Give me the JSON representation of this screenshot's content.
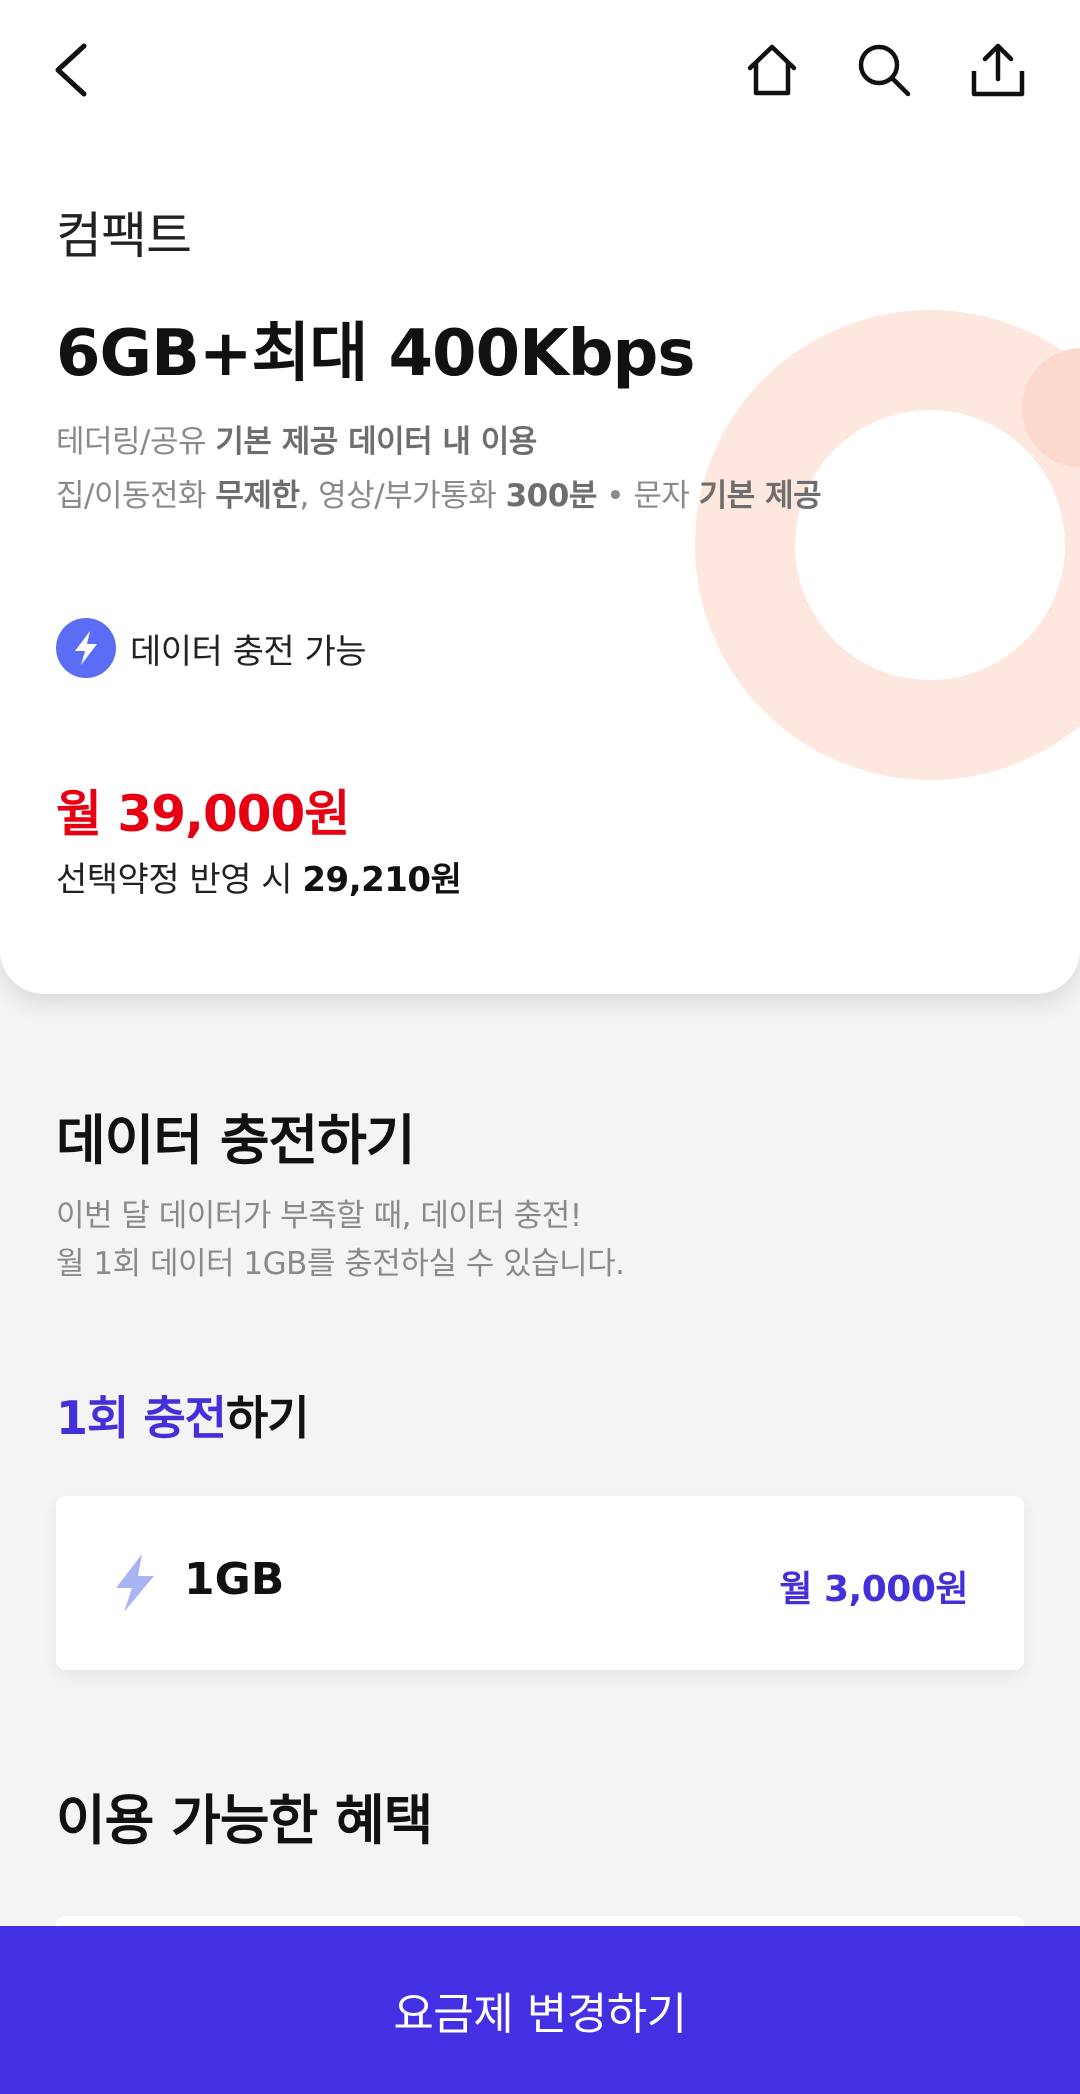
{
  "header": {
    "back_icon": "chevron-left-icon",
    "home_icon": "home-icon",
    "search_icon": "search-icon",
    "share_icon": "share-icon"
  },
  "plan": {
    "name": "컴팩트",
    "title": "6GB+최대 400Kbps",
    "desc_line1": {
      "prefix": "테더링/공유 ",
      "bold": "기본 제공 데이터 내 이용"
    },
    "desc_line2": {
      "part1": "집/이동전화 ",
      "bold1": "무제한",
      "part2": ", 영상/부가통화 ",
      "bold2": "300분",
      "part3": " • 문자 ",
      "bold3": "기본 제공"
    },
    "badge_label": "데이터 충전 가능",
    "price": "월 39,000원",
    "discount_prefix": "선택약정 반영 시 ",
    "discount_price": "29,210원"
  },
  "recharge": {
    "title": "데이터 충전하기",
    "desc_line1": "이번 달 데이터가 부족할 때, 데이터 충전!",
    "desc_line2": "월 1회 데이터 1GB를 충전하실 수 있습니다.",
    "subtitle_accent": "1회 충전",
    "subtitle_rest": "하기",
    "option": {
      "amount": "1GB",
      "price": "월 3,000원"
    }
  },
  "benefits": {
    "title": "이용 가능한 혜택"
  },
  "cta_label": "요금제 변경하기",
  "colors": {
    "accent": "#4330e2",
    "price_red": "#e60012",
    "badge_blue": "#5b6df5",
    "deco_peach": "#fde7df"
  }
}
